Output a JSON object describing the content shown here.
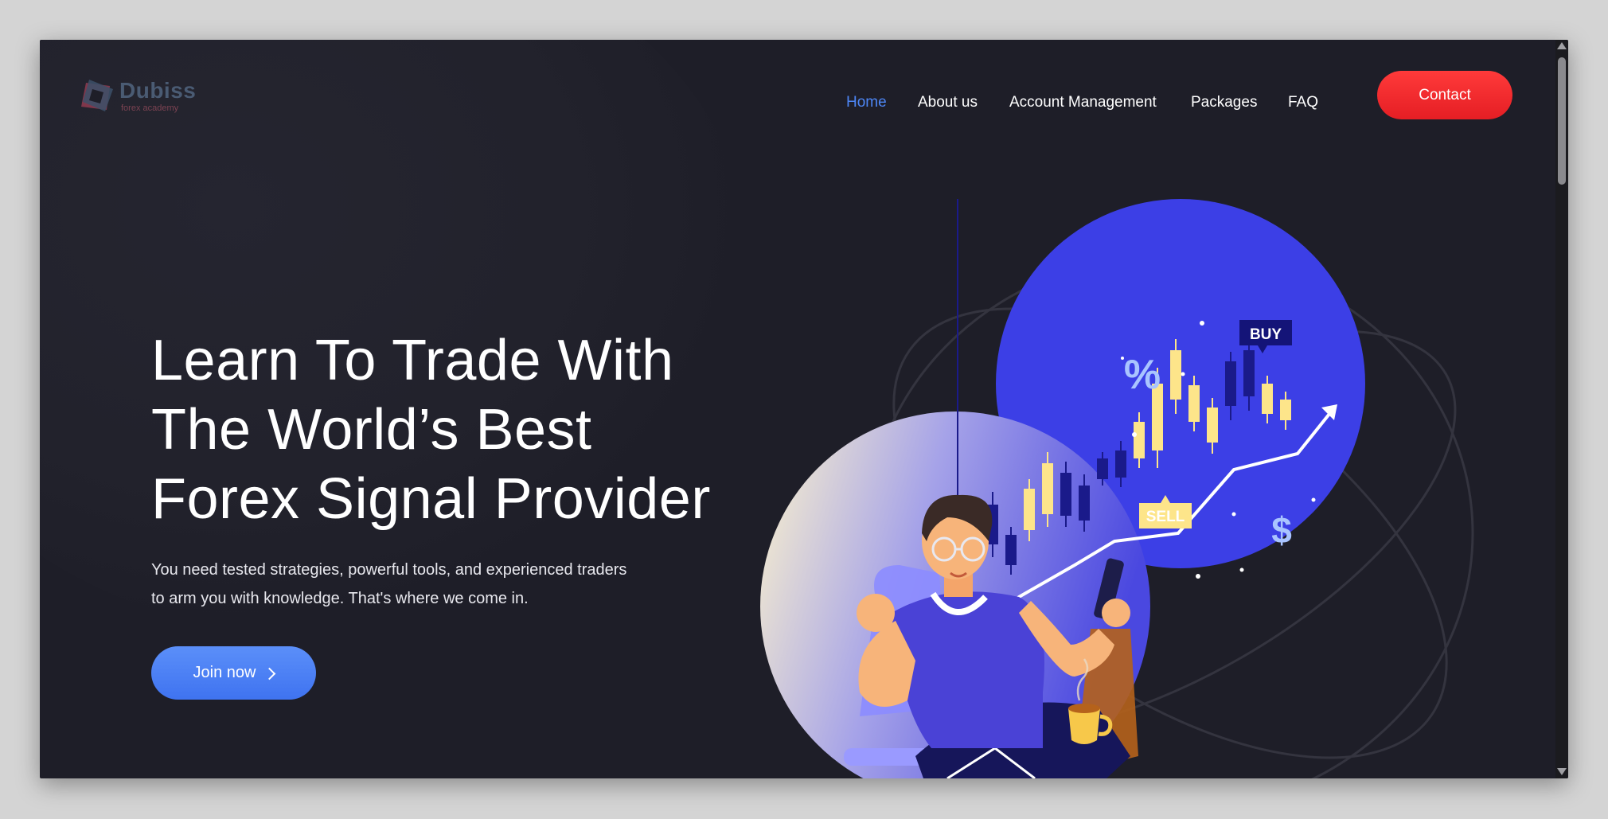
{
  "brand": {
    "name": "Dubiss",
    "tagline": "forex academy",
    "colors": {
      "name": "#4a5b73",
      "tagline": "#7c4352"
    }
  },
  "nav": {
    "items": [
      {
        "label": "Home",
        "active": true
      },
      {
        "label": "About us",
        "active": false
      },
      {
        "label": "Account Management",
        "active": false
      },
      {
        "label": "Packages",
        "active": false
      },
      {
        "label": "FAQ",
        "active": false
      }
    ],
    "contact_label": "Contact"
  },
  "hero": {
    "title_lines": [
      "Learn To Trade With",
      "The World’s Best",
      "Forex Signal Provider"
    ],
    "description_lines": [
      "You need tested strategies, powerful tools, and experienced traders",
      "to arm you with knowledge. That's where we come in."
    ],
    "cta_label": "Join now"
  },
  "illustration": {
    "buy_label": "BUY",
    "sell_label": "SELL",
    "percent_symbol": "%",
    "dollar_symbol": "$",
    "icons": [
      "chevron-right-icon",
      "trader-illustration",
      "candlestick-chart-icon",
      "smartphone-icon",
      "coffee-cup-icon"
    ]
  },
  "colors": {
    "background": "#1e1e28",
    "active_nav": "#4d86f5",
    "contact": "#f0282c",
    "cta": "#4a80f5",
    "illustration_blue": "#3c3fe6",
    "candle_yellow": "#fde58a",
    "candle_navy": "#1a1a8a"
  }
}
